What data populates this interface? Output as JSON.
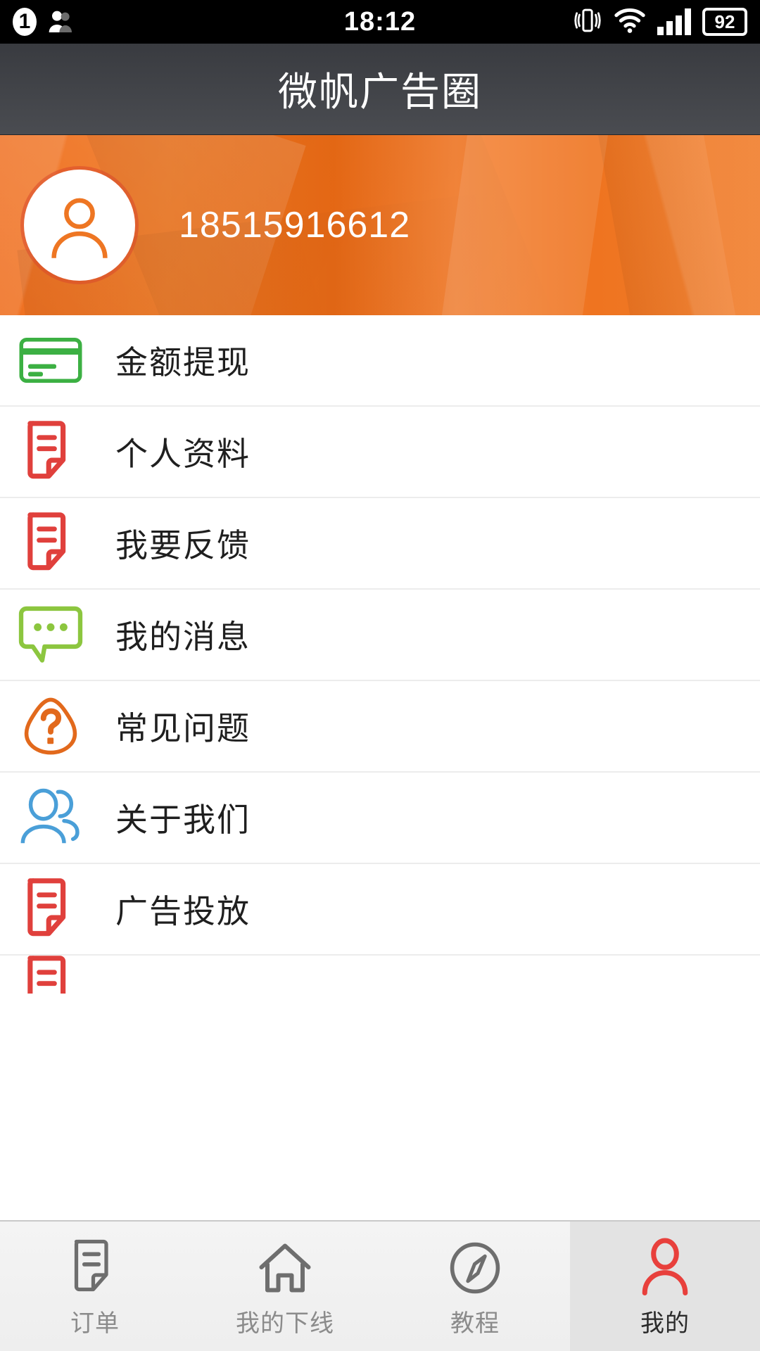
{
  "status_bar": {
    "notification_count": "1",
    "time": "18:12",
    "battery_percent": "92",
    "icons": [
      "notification-badge-icon",
      "contacts-icon",
      "vibrate-icon",
      "wifi-icon",
      "signal-bars-icon",
      "battery-icon"
    ]
  },
  "header": {
    "title": "微帆广告圈"
  },
  "profile": {
    "phone": "18515916612",
    "avatar_icon": "user-avatar-icon",
    "banner_color": "#ef6c1b"
  },
  "menu": {
    "items": [
      {
        "label": "金额提现",
        "icon": "credit-card-icon",
        "color": "#3cb043"
      },
      {
        "label": "个人资料",
        "icon": "document-icon",
        "color": "#e0403c"
      },
      {
        "label": "我要反馈",
        "icon": "document-icon",
        "color": "#e0403c"
      },
      {
        "label": "我的消息",
        "icon": "chat-bubble-icon",
        "color": "#8cc63f"
      },
      {
        "label": "常见问题",
        "icon": "question-mark-icon",
        "color": "#e2691c"
      },
      {
        "label": "关于我们",
        "icon": "users-group-icon",
        "color": "#4a9fd8"
      },
      {
        "label": "广告投放",
        "icon": "document-icon",
        "color": "#e0403c"
      },
      {
        "label": "",
        "icon": "document-icon",
        "color": "#e0403c"
      }
    ]
  },
  "tab_bar": {
    "active_index": 3,
    "tabs": [
      {
        "label": "订单",
        "icon": "document-icon"
      },
      {
        "label": "我的下线",
        "icon": "home-icon"
      },
      {
        "label": "教程",
        "icon": "compass-icon"
      },
      {
        "label": "我的",
        "icon": "person-icon"
      }
    ],
    "active_color": "#e8403c",
    "inactive_color": "#6e6e6e"
  }
}
